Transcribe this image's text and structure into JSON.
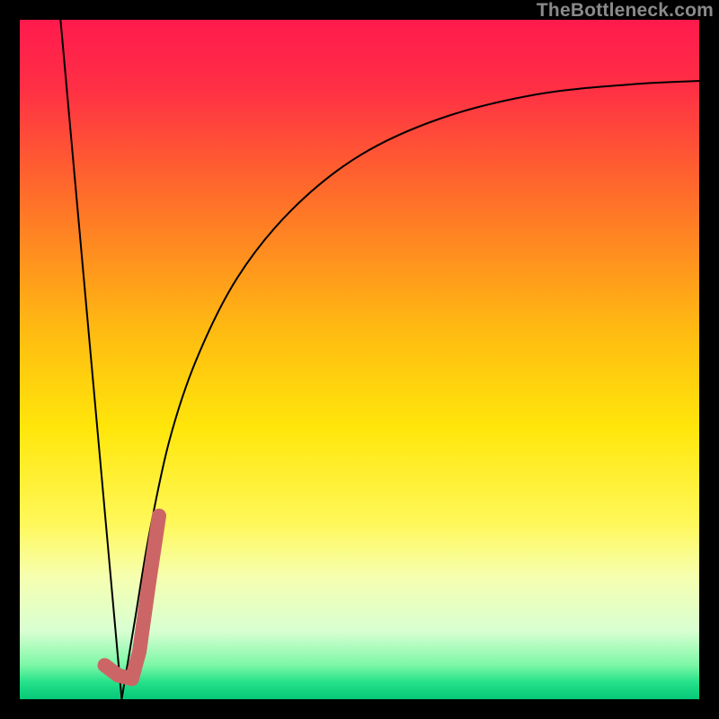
{
  "watermark": "TheBottleneck.com",
  "colors": {
    "background": "#000000",
    "gradient_stops": [
      {
        "pos": 0.0,
        "color": "#ff1a4d"
      },
      {
        "pos": 0.1,
        "color": "#ff2f45"
      },
      {
        "pos": 0.25,
        "color": "#ff6a2b"
      },
      {
        "pos": 0.45,
        "color": "#ffb812"
      },
      {
        "pos": 0.6,
        "color": "#ffe60a"
      },
      {
        "pos": 0.74,
        "color": "#fff859"
      },
      {
        "pos": 0.82,
        "color": "#f6ffb0"
      },
      {
        "pos": 0.9,
        "color": "#d8ffd2"
      },
      {
        "pos": 0.95,
        "color": "#7cf7a6"
      },
      {
        "pos": 0.975,
        "color": "#25e18a"
      },
      {
        "pos": 1.0,
        "color": "#05c877"
      }
    ],
    "curve": "#000000",
    "marker_fill": "#cc6666",
    "marker_stroke": "#cc6666"
  },
  "chart_data": {
    "type": "line",
    "title": "",
    "xlabel": "",
    "ylabel": "",
    "x_range": [
      0,
      100
    ],
    "y_range": [
      0,
      100
    ],
    "series": [
      {
        "name": "left-edge",
        "x": [
          6,
          15
        ],
        "y": [
          100,
          0
        ]
      },
      {
        "name": "main-curve",
        "x": [
          15,
          17,
          19,
          22,
          26,
          32,
          40,
          50,
          62,
          76,
          90,
          100
        ],
        "y": [
          0,
          12,
          24,
          38,
          50,
          62,
          72,
          80,
          85.5,
          89,
          90.5,
          91
        ]
      }
    ],
    "marker": {
      "name": "j-marker",
      "points": [
        {
          "x": 20.5,
          "y": 27
        },
        {
          "x": 19.0,
          "y": 17
        },
        {
          "x": 17.6,
          "y": 7
        },
        {
          "x": 16.5,
          "y": 3
        },
        {
          "x": 14.5,
          "y": 3.5
        },
        {
          "x": 12.5,
          "y": 5
        }
      ]
    }
  }
}
